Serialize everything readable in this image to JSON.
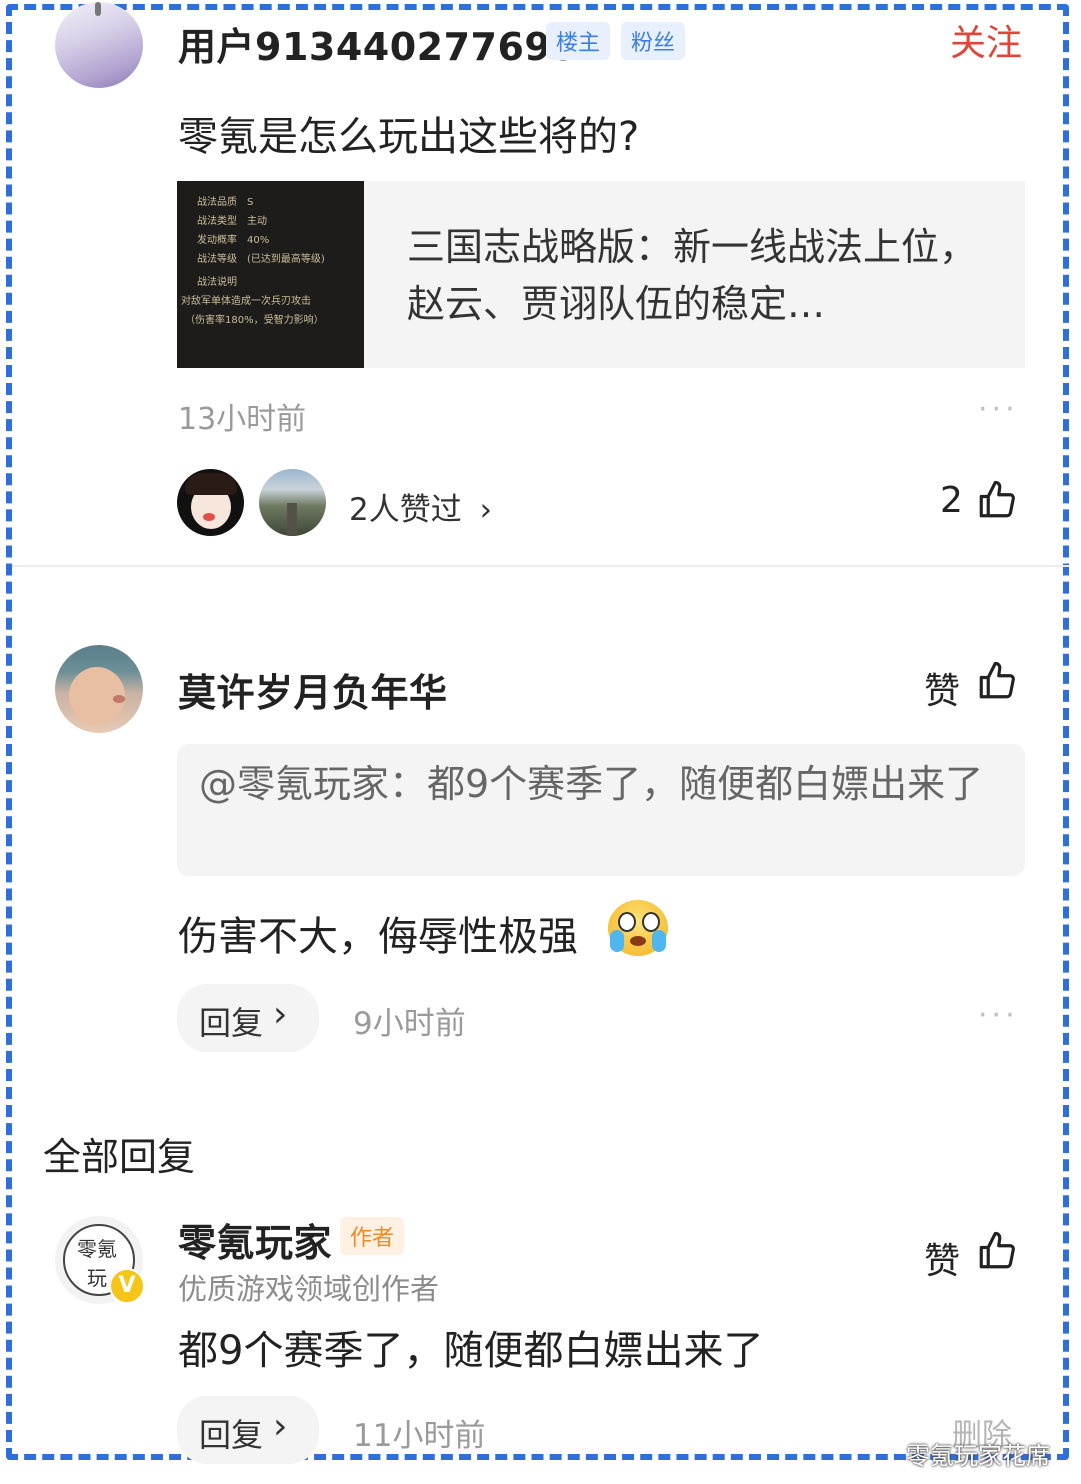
{
  "post": {
    "username": "用户9134402776952",
    "badge_owner": "楼主",
    "badge_fan": "粉丝",
    "follow_label": "关注",
    "text": "零氪是怎么玩出这些将的?",
    "link_card": {
      "title": "三国志战略版：新一线战法上位，赵云、贾诩队伍的稳定…",
      "thumb_lines": [
        [
          "战法品质",
          "S"
        ],
        [
          "战法类型",
          "主动"
        ],
        [
          "发动概率",
          "40%"
        ],
        [
          "战法等级",
          "(已达到最高等级)"
        ]
      ],
      "thumb_desc_title": "战法说明",
      "thumb_desc_1": "对敌军单体造成一次兵刃攻击",
      "thumb_desc_2": "（伤害率180%，受智力影响）"
    },
    "time": "13小时前",
    "more": "···",
    "likers_text": "2人赞过",
    "likers_chevron": "›",
    "like_count": "2"
  },
  "comment": {
    "username": "莫许岁月负年华",
    "like_label": "赞",
    "quote": "@零氪玩家：都9个赛季了，随便都白嫖出来了",
    "text": "伤害不大，侮辱性极强",
    "reply_label": "回复",
    "reply_chevron": "›",
    "time": "9小时前",
    "more": "···"
  },
  "section_title": "全部回复",
  "reply": {
    "username": "零氪玩家",
    "badge_author": "作者",
    "subtitle": "优质游戏领域创作者",
    "avatar_text_1": "零氪",
    "avatar_text_2": "玩",
    "verified": "V",
    "like_label": "赞",
    "text": "都9个赛季了，随便都白嫖出来了",
    "reply_label": "回复",
    "reply_chevron": "›",
    "time": "11小时前",
    "delete_label": "删除"
  },
  "watermark": "零氪玩家花席",
  "colors": {
    "accent_blue": "#2f6fdc",
    "follow_red": "#e0453a",
    "author_orange": "#f08a24",
    "verified_yellow": "#f5c518"
  }
}
